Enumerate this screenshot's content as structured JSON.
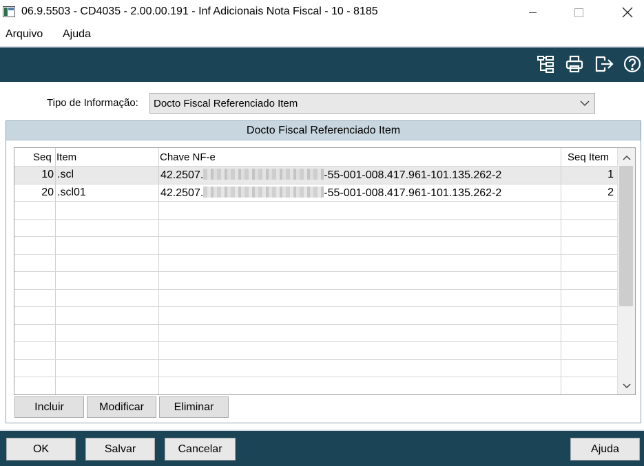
{
  "window": {
    "title": "06.9.5503 - CD4035 - 2.00.00.191 - Inf Adicionais Nota Fiscal - 10 - 8185",
    "controls": [
      "minimize-icon",
      "maximize-icon",
      "close-icon"
    ]
  },
  "menu": {
    "items": [
      "Arquivo",
      "Ajuda"
    ]
  },
  "toolbar": {
    "icons": [
      "tree-structure-icon",
      "print-icon",
      "exit-icon",
      "help-icon"
    ]
  },
  "form": {
    "tipo_label": "Tipo de Informação:",
    "tipo_value": "Docto Fiscal Referenciado Item"
  },
  "panel": {
    "title": "Docto Fiscal Referenciado Item"
  },
  "table": {
    "columns": [
      "Seq",
      "Item",
      "Chave NF-e",
      "Seq Item"
    ],
    "rows": [
      {
        "seq": "10",
        "item": ".scl",
        "chave_prefix": "42.2507.",
        "chave_suffix": "-55-001-008.417.961-101.135.262-2",
        "seq_item": "1"
      },
      {
        "seq": "20",
        "item": ".scl01",
        "chave_prefix": "42.2507.",
        "chave_suffix": "-55-001-008.417.961-101.135.262-2",
        "seq_item": "2"
      }
    ]
  },
  "grid_buttons": {
    "incluir": "Incluir",
    "modificar": "Modificar",
    "eliminar": "Eliminar"
  },
  "footer_buttons": {
    "ok": "OK",
    "salvar": "Salvar",
    "cancelar": "Cancelar",
    "ajuda": "Ajuda"
  },
  "colors": {
    "bar": "#1b4457",
    "panel_header": "#c8d6df",
    "selected_row": "#e9e9e9"
  }
}
